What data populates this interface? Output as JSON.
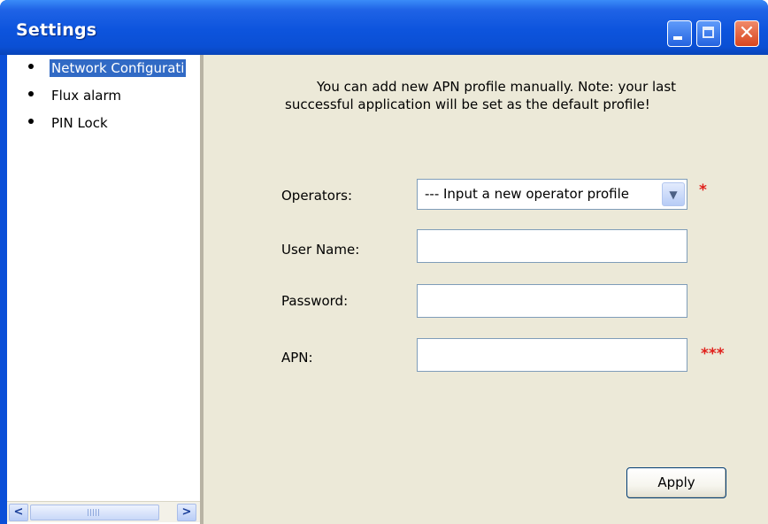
{
  "window": {
    "title": "Settings",
    "controls": {
      "minimize": "minimize-icon",
      "maximize": "maximize-icon",
      "close": "close-icon"
    }
  },
  "sidebar": {
    "items": [
      {
        "label": "Network Configurati",
        "selected": true
      },
      {
        "label": "Flux alarm",
        "selected": false
      },
      {
        "label": "PIN Lock",
        "selected": false
      }
    ],
    "scrollbar": {
      "left_icon": "chevron-left-icon",
      "right_icon": "chevron-right-icon"
    }
  },
  "main": {
    "note": "You can add new APN profile manually. Note: your last successful application will be set as the default profile!",
    "operators": {
      "label": "Operators:",
      "value": "--- Input a new operator profile",
      "required_mark": "*"
    },
    "username": {
      "label": "User Name:",
      "value": ""
    },
    "password": {
      "label": "Password:",
      "value": ""
    },
    "apn": {
      "label": "APN:",
      "value": "",
      "required_mark": "***"
    },
    "apply_label": "Apply"
  },
  "colors": {
    "title_bar": "#0a4fd8",
    "selection": "#316ac5",
    "panel": "#ece9d8",
    "required": "#e0201b"
  }
}
